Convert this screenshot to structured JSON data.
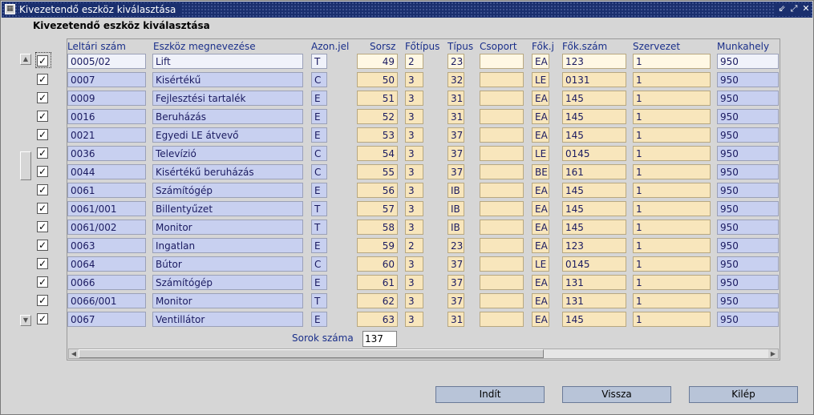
{
  "window": {
    "title": "Kivezetendő eszköz kiválasztása",
    "controls": [
      "⇙",
      "⤢",
      "✕"
    ]
  },
  "section_title": "Kivezetendő eszköz kiválasztása",
  "columns": [
    "Leltári szám",
    "Eszköz megnevezése",
    "Azon.jel",
    "Sorsz",
    "Főtípus",
    "Típus",
    "Csoport",
    "Fők.j",
    "Fők.szám",
    "Szervezet",
    "Munkahely"
  ],
  "rows": [
    {
      "checked": true,
      "leltari": "0005/02",
      "nev": "Lift",
      "azon": "T",
      "sorsz": "49",
      "fotipus": "2",
      "tipus": "23",
      "csoport": "",
      "fokj": "EA",
      "fokszam": "123",
      "szervezet": "1",
      "munkahely": "950"
    },
    {
      "checked": true,
      "leltari": "0007",
      "nev": "Kisértékű",
      "azon": "C",
      "sorsz": "50",
      "fotipus": "3",
      "tipus": "32",
      "csoport": "",
      "fokj": "LE",
      "fokszam": "0131",
      "szervezet": "1",
      "munkahely": "950"
    },
    {
      "checked": true,
      "leltari": "0009",
      "nev": "Fejlesztési tartalék",
      "azon": "E",
      "sorsz": "51",
      "fotipus": "3",
      "tipus": "31",
      "csoport": "",
      "fokj": "EA",
      "fokszam": "145",
      "szervezet": "1",
      "munkahely": "950"
    },
    {
      "checked": true,
      "leltari": "0016",
      "nev": "Beruházás",
      "azon": "E",
      "sorsz": "52",
      "fotipus": "3",
      "tipus": "31",
      "csoport": "",
      "fokj": "EA",
      "fokszam": "145",
      "szervezet": "1",
      "munkahely": "950"
    },
    {
      "checked": true,
      "leltari": "0021",
      "nev": "Egyedi LE átvevő",
      "azon": "E",
      "sorsz": "53",
      "fotipus": "3",
      "tipus": "37",
      "csoport": "",
      "fokj": "EA",
      "fokszam": "145",
      "szervezet": "1",
      "munkahely": "950"
    },
    {
      "checked": true,
      "leltari": "0036",
      "nev": "Televízió",
      "azon": "C",
      "sorsz": "54",
      "fotipus": "3",
      "tipus": "37",
      "csoport": "",
      "fokj": "LE",
      "fokszam": "0145",
      "szervezet": "1",
      "munkahely": "950"
    },
    {
      "checked": true,
      "leltari": "0044",
      "nev": "Kisértékű beruházás",
      "azon": "C",
      "sorsz": "55",
      "fotipus": "3",
      "tipus": "37",
      "csoport": "",
      "fokj": "BE",
      "fokszam": "161",
      "szervezet": "1",
      "munkahely": "950"
    },
    {
      "checked": true,
      "leltari": "0061",
      "nev": "Számítógép",
      "azon": "E",
      "sorsz": "56",
      "fotipus": "3",
      "tipus": "IB",
      "csoport": "",
      "fokj": "EA",
      "fokszam": "145",
      "szervezet": "1",
      "munkahely": "950"
    },
    {
      "checked": true,
      "leltari": "0061/001",
      "nev": "Billentyűzet",
      "azon": "T",
      "sorsz": "57",
      "fotipus": "3",
      "tipus": "IB",
      "csoport": "",
      "fokj": "EA",
      "fokszam": "145",
      "szervezet": "1",
      "munkahely": "950"
    },
    {
      "checked": true,
      "leltari": "0061/002",
      "nev": "Monitor",
      "azon": "T",
      "sorsz": "58",
      "fotipus": "3",
      "tipus": "IB",
      "csoport": "",
      "fokj": "EA",
      "fokszam": "145",
      "szervezet": "1",
      "munkahely": "950"
    },
    {
      "checked": true,
      "leltari": "0063",
      "nev": "Ingatlan",
      "azon": "E",
      "sorsz": "59",
      "fotipus": "2",
      "tipus": "23",
      "csoport": "",
      "fokj": "EA",
      "fokszam": "123",
      "szervezet": "1",
      "munkahely": "950"
    },
    {
      "checked": true,
      "leltari": "0064",
      "nev": "Bútor",
      "azon": "C",
      "sorsz": "60",
      "fotipus": "3",
      "tipus": "37",
      "csoport": "",
      "fokj": "LE",
      "fokszam": "0145",
      "szervezet": "1",
      "munkahely": "950"
    },
    {
      "checked": true,
      "leltari": "0066",
      "nev": "Számítógép",
      "azon": "E",
      "sorsz": "61",
      "fotipus": "3",
      "tipus": "37",
      "csoport": "",
      "fokj": "EA",
      "fokszam": "131",
      "szervezet": "1",
      "munkahely": "950"
    },
    {
      "checked": true,
      "leltari": "0066/001",
      "nev": "Monitor",
      "azon": "T",
      "sorsz": "62",
      "fotipus": "3",
      "tipus": "37",
      "csoport": "",
      "fokj": "EA",
      "fokszam": "131",
      "szervezet": "1",
      "munkahely": "950"
    },
    {
      "checked": true,
      "leltari": "0067",
      "nev": "Ventillátor",
      "azon": "E",
      "sorsz": "63",
      "fotipus": "3",
      "tipus": "31",
      "csoport": "",
      "fokj": "EA",
      "fokszam": "145",
      "szervezet": "1",
      "munkahely": "950"
    }
  ],
  "row_count": {
    "label": "Sorok száma",
    "value": "137"
  },
  "buttons": {
    "start": "Indít",
    "back": "Vissza",
    "exit": "Kilép"
  },
  "colors": {
    "titlebar": "#1a2f6e",
    "cell_blue": "#c8d0f0",
    "cell_yellow": "#f8e6bc",
    "header_text": "#1a2f8a",
    "button": "#b8c4d8"
  }
}
